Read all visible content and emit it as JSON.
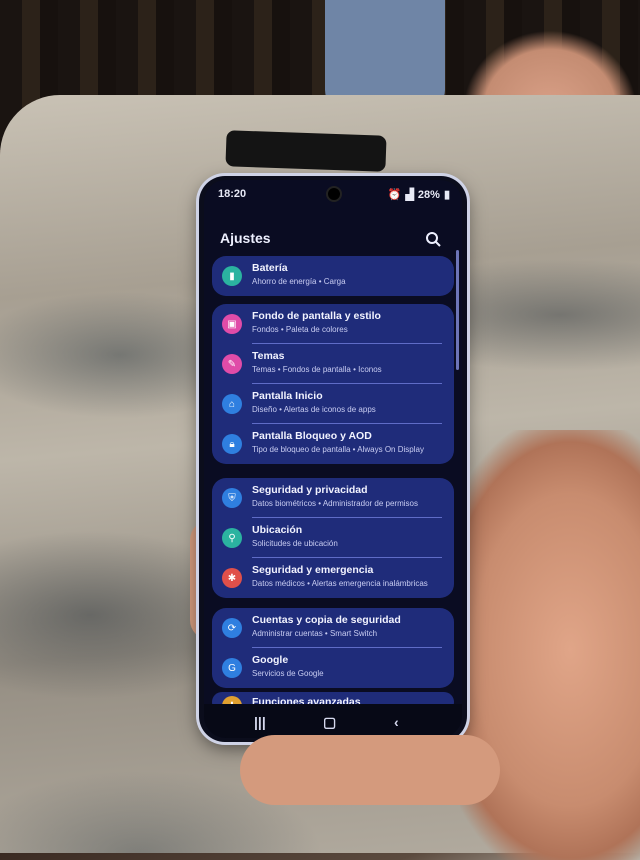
{
  "status_bar": {
    "time": "18:20",
    "battery": "28%"
  },
  "header": {
    "title": "Ajustes"
  },
  "groups": [
    {
      "items": [
        {
          "title": "Batería",
          "subtitle": "Ahorro de energía • Carga",
          "icon": "battery-icon",
          "color": "#2bb3a0"
        }
      ]
    },
    {
      "items": [
        {
          "title": "Fondo de pantalla y estilo",
          "subtitle": "Fondos • Paleta de colores",
          "icon": "wallpaper-icon",
          "color": "#e04ca8"
        },
        {
          "title": "Temas",
          "subtitle": "Temas • Fondos de pantalla • Iconos",
          "icon": "themes-icon",
          "color": "#e04ca8"
        },
        {
          "title": "Pantalla Inicio",
          "subtitle": "Diseño • Alertas de iconos de apps",
          "icon": "home-icon",
          "color": "#2f7fe0"
        },
        {
          "title": "Pantalla Bloqueo y AOD",
          "subtitle": "Tipo de bloqueo de pantalla • Always On Display",
          "icon": "lock-icon",
          "color": "#2f7fe0"
        }
      ]
    },
    {
      "items": [
        {
          "title": "Seguridad y privacidad",
          "subtitle": "Datos biométricos • Administrador de permisos",
          "icon": "shield-icon",
          "color": "#2f7fe0"
        },
        {
          "title": "Ubicación",
          "subtitle": "Solicitudes de ubicación",
          "icon": "location-icon",
          "color": "#2bb3a0"
        },
        {
          "title": "Seguridad y emergencia",
          "subtitle": "Datos médicos • Alertas emergencia inalámbricas",
          "icon": "emergency-icon",
          "color": "#e0504a"
        }
      ]
    },
    {
      "items": [
        {
          "title": "Cuentas y copia de seguridad",
          "subtitle": "Administrar cuentas • Smart Switch",
          "icon": "sync-icon",
          "color": "#2f7fe0"
        },
        {
          "title": "Google",
          "subtitle": "Servicios de Google",
          "icon": "google-icon",
          "color": "#2f7fe0"
        }
      ]
    },
    {
      "items": [
        {
          "title": "Funciones avanzadas",
          "subtitle": "",
          "icon": "advanced-icon",
          "color": "#e0a030"
        }
      ]
    }
  ],
  "colors": {
    "group_bg": "#1f2c7a",
    "screen_bg": "#0a0c22",
    "accent": "#2f7fe0"
  }
}
